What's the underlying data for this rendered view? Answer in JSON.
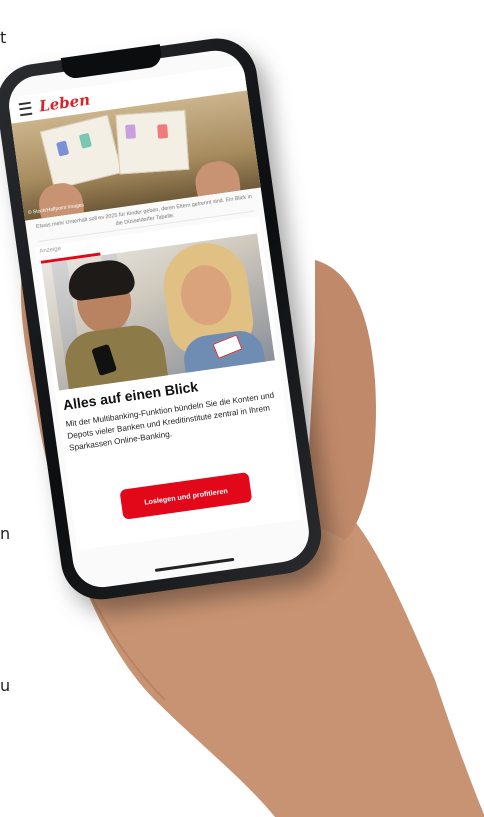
{
  "edge_chars": [
    "t",
    "n",
    "u"
  ],
  "nav": {
    "logo": "Leben"
  },
  "photo": {
    "copyright": "© Stock/Halfpoint Images"
  },
  "article": {
    "caption": "Etwas mehr Unterhalt soll es 2025 für Kinder geben, deren Eltern getrennt sind. Ein Blick in die Düsseldorfer Tabelle."
  },
  "ad": {
    "label": "Anzeige",
    "headline": "Alles auf einen Blick",
    "body": "Mit der Multibanking-Funktion bündeln Sie die Konten und Depots vieler Banken und Kreditinstitute zentral in Ihrem Sparkassen Online-Banking.",
    "cta": "Loslegen und profitieren"
  },
  "colors": {
    "brand_red": "#e3071a",
    "logo_red": "#d8232a",
    "phone_frame": "#0c0d0f",
    "skin": "#c89372"
  },
  "icons": [
    "menu-icon"
  ]
}
